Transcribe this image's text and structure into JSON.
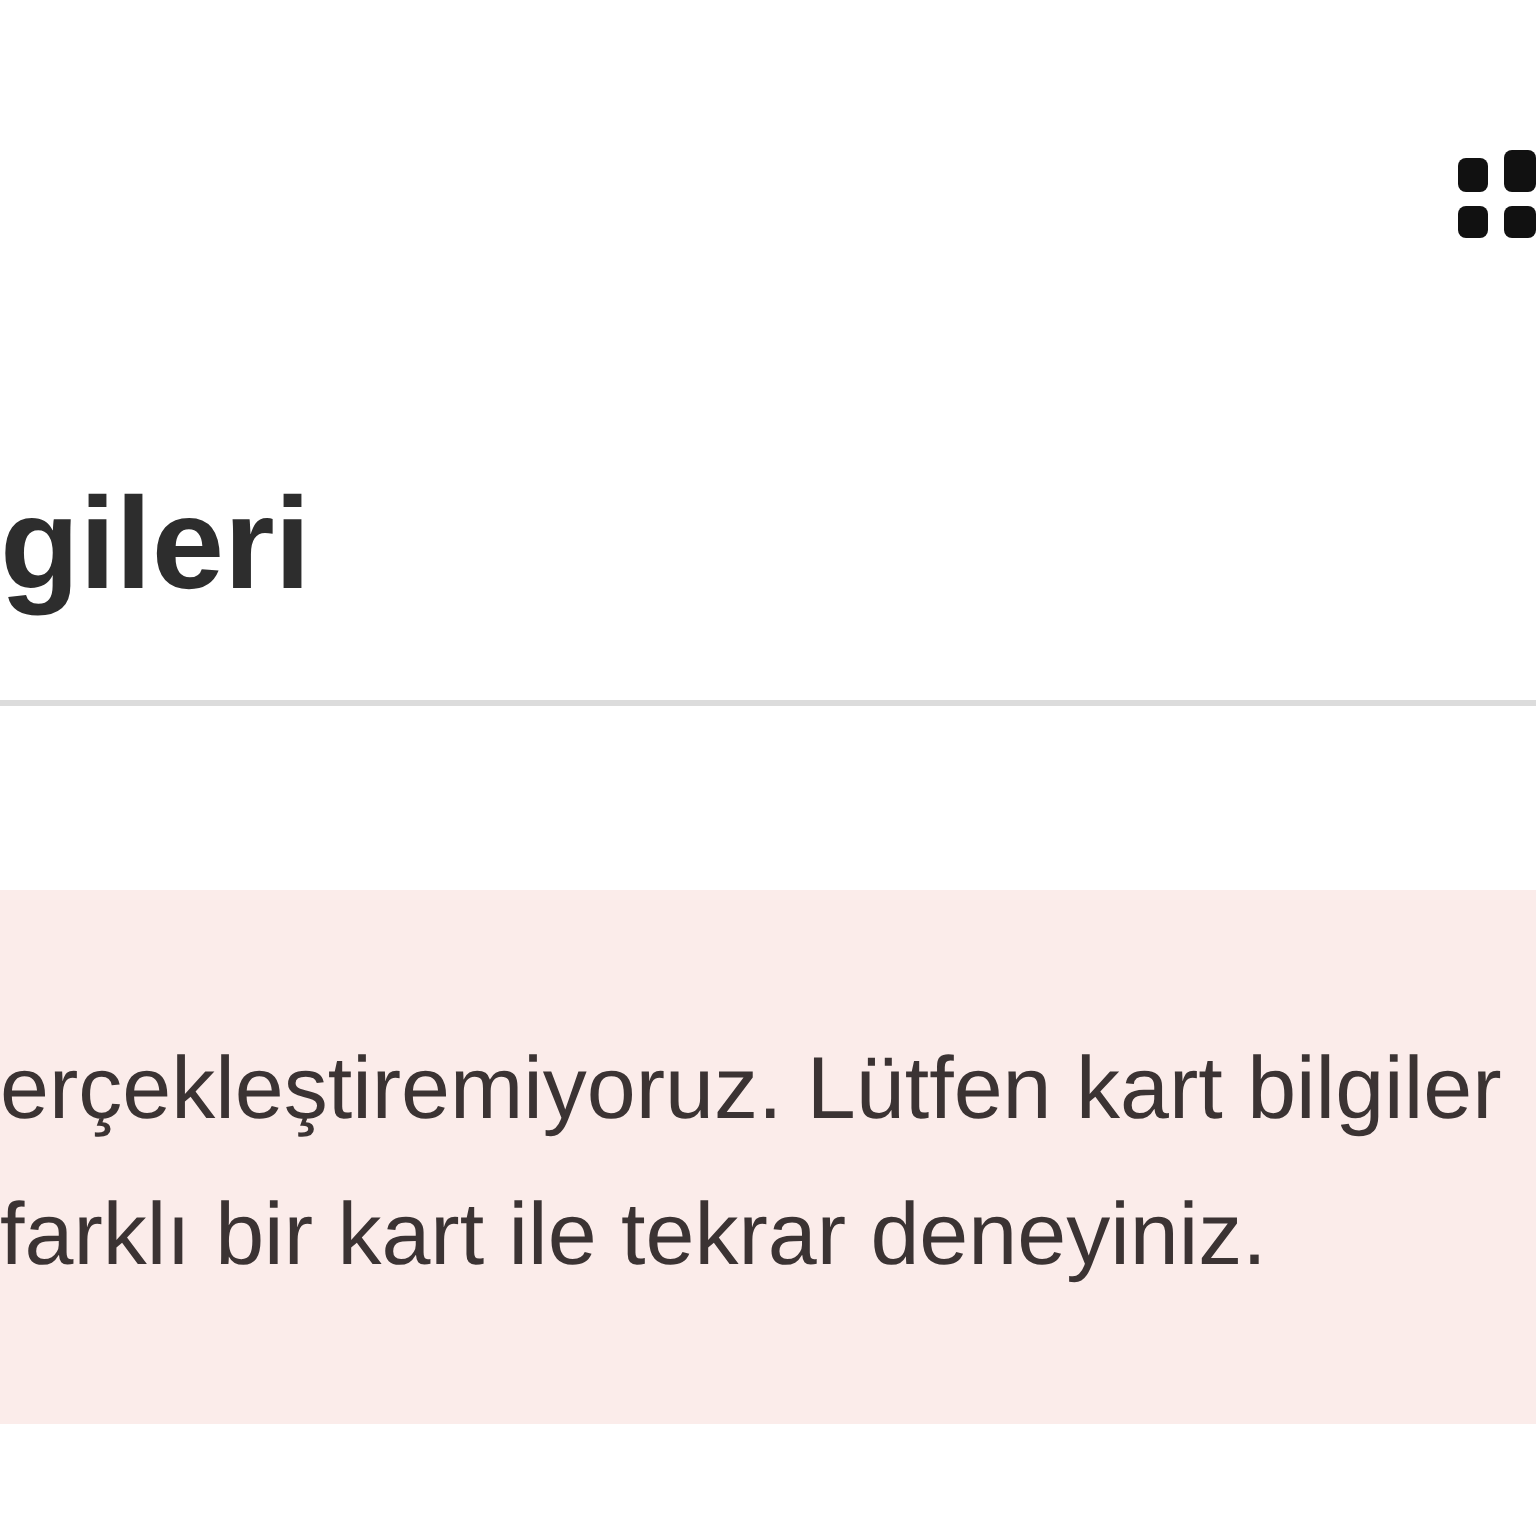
{
  "title": "gileri",
  "alert": {
    "kind": "error",
    "message": "erçekleştiremiyoruz. Lütfen kart bilgiler\nfarklı bir kart ile tekrar deneyiniz."
  }
}
